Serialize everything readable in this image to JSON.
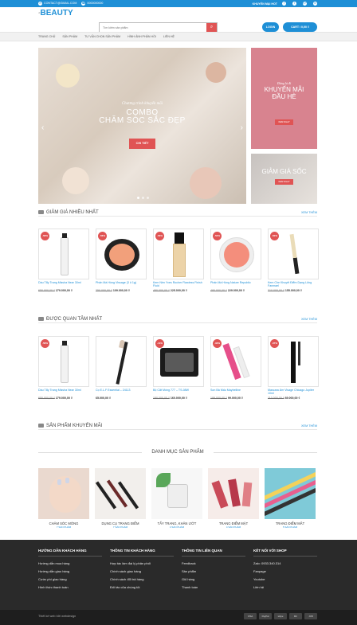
{
  "topbar": {
    "email": "CONTACT@GMAIL.COM",
    "phone": "0000000000",
    "promo_link": "KHUYẾN MẠI HOT",
    "social": [
      "f",
      "t",
      "G+",
      "in"
    ]
  },
  "header": {
    "logo_prefix": "dt",
    "logo": "BEAUTY",
    "search_placeholder": "Tìm kiếm sản phẩm",
    "login_label": "LOGIN",
    "cart_label": "CART / 0,00 ₫"
  },
  "nav": [
    "TRANG CHỦ",
    "SẢN PHẨM",
    "TƯ VẤN CHỌN SẢN PHẨM",
    "HÌNH ẢNH PHẢN HỒI",
    "LIÊN HỆ"
  ],
  "banner": {
    "subtitle": "Chương trình khuyến mãi",
    "title_line1": "COMBO",
    "title_line2": "CHĂM SÓC SẮC ĐẸP",
    "cta": "CHI TIẾT"
  },
  "side_banner_1": {
    "subtitle": "Đúng là đỉ",
    "title_line1": "KHUYẾN MÃI",
    "title_line2": "ĐẦU HÈ",
    "cta": "XEM NGAY"
  },
  "side_banner_2": {
    "title": "GIẢM GIÁ SỐC",
    "cta": "XEM NGAY"
  },
  "section1": {
    "title": "GIẢM GIÁ NHIỀU NHẤT",
    "more": "XEM THÊM",
    "products": [
      {
        "badge": "-58%",
        "name": "Dầu Tẩy Trang Missha Near 30ml",
        "old": "650.000,00 ₫",
        "price": "279.000,00 ₫"
      },
      {
        "badge": "-56%",
        "name": "Phấn Má Hồng Vissage (3 ô 1g)",
        "old": "250.000,00 ₫",
        "price": "109.000,00 ₫"
      },
      {
        "badge": "-53%",
        "name": "Kem Nền Yves Rocher Flawless Finish Fluid",
        "old": "480.000,00 ₫",
        "price": "225.000,00 ₫"
      },
      {
        "badge": "-52%",
        "name": "Phấn Má Hồng Nature Republic",
        "old": "480.000,00 ₫",
        "price": "229.000,00 ₫"
      },
      {
        "badge": "-50%",
        "name": "Kem Che Khuyết Điểm Dạng Lỏng Fanmael",
        "old": "310.000,00 ₫",
        "price": "155.000,00 ₫"
      }
    ]
  },
  "section2": {
    "title": "ĐƯỢC QUAN TÂM NHẤT",
    "more": "XEM THÊM",
    "products": [
      {
        "badge": "-58%",
        "name": "Dầu Tẩy Trang Missha Near 30ml",
        "old": "650.000,00 ₫",
        "price": "279.000,00 ₫"
      },
      {
        "badge": "",
        "name": "Cọ E.L.F Essential – 24113",
        "old": "",
        "price": "65.000,00 ₫"
      },
      {
        "badge": "-11%",
        "name": "Bộ Cắt Móng 777 – TS-08W",
        "old": "180.000,00 ₫",
        "price": "160.000,00 ₫"
      },
      {
        "badge": "-33%",
        "name": "Son Bà Mấu Maybelline",
        "old": "189.000,00 ₫",
        "price": "99.000,00 ₫"
      },
      {
        "badge": "-37%",
        "name": "Mascara Ảm Visage Chicago Jupiter 10ml",
        "old": "110.000,00 ₫",
        "price": "69.000,00 ₫"
      }
    ]
  },
  "section3": {
    "title": "SẢN PHẨM KHUYẾN MÃI",
    "more": "XEM THÊM"
  },
  "categories": {
    "title": "DANH MỤC SẢN PHẨM",
    "items": [
      {
        "label": "CHĂM SÓC MÓNG",
        "count": "7 SẢN PHẨM"
      },
      {
        "label": "DỤNG CỤ TRANG ĐIỂM",
        "count": "7 SẢN PHẨM"
      },
      {
        "label": "TẨY TRANG, KHĂN ƯỚT",
        "count": "4 SẢN PHẨM"
      },
      {
        "label": "TRANG ĐIỂM MẶT",
        "count": "4 SẢN PHẨM"
      },
      {
        "label": "TRANG ĐIỂM MẮT",
        "count": "5 SẢN PHẨM"
      }
    ]
  },
  "footer": {
    "col1": {
      "title": "HƯỚNG DẪN KHÁCH HÀNG",
      "items": [
        "Hướng dẫn mua hàng",
        "Hướng dẫn giao hàng",
        "Cước phí giao hàng",
        "Hình thức thanh toán"
      ]
    },
    "col2": {
      "title": "THÔNG TIN KHÁCH HÀNG",
      "items": [
        "Hợp tác làm đại lý phân phối",
        "Chính sách giao hàng",
        "Chính sách đổi trả hàng",
        "Đối tác của chúng tôi"
      ]
    },
    "col3": {
      "title": "THÔNG TIN LIÊN QUAN",
      "items": [
        "Feedback",
        "Sản phẩm",
        "Giỏ hàng",
        "Thanh toán"
      ]
    },
    "col4": {
      "title": "KẾT NỐI VỚI SHOP",
      "items": [
        "Zalo: 0933.340.314",
        "Fanpage",
        "Youtube",
        "Liên hệ"
      ]
    },
    "copyright": "Thiết kế web bởi webdesign",
    "payments": [
      "VISA",
      "PayPal",
      "stripe",
      "MC",
      "JCB"
    ]
  }
}
